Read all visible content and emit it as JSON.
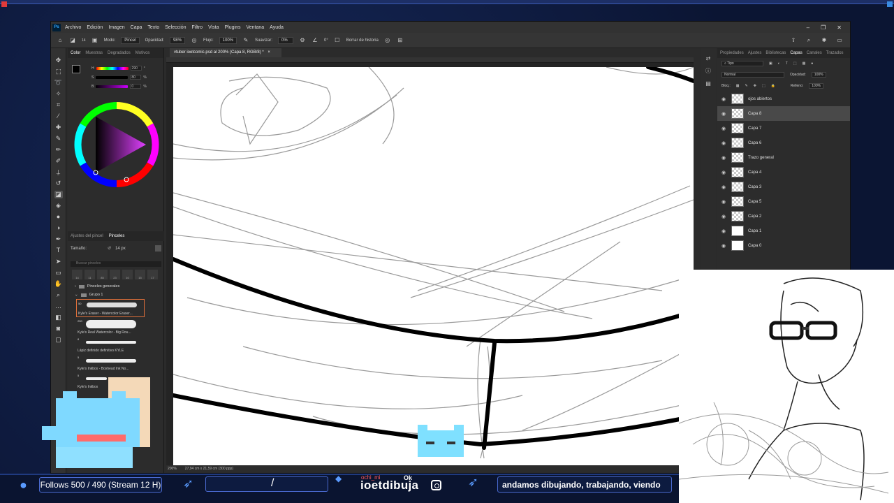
{
  "app": {
    "logo": "Ps",
    "menu": [
      "Archivo",
      "Edición",
      "Imagen",
      "Capa",
      "Texto",
      "Selección",
      "Filtro",
      "Vista",
      "Plugins",
      "Ventana",
      "Ayuda"
    ]
  },
  "options": {
    "mode_label": "Modo:",
    "mode_value": "Pincel",
    "opacity_label": "Opacidad:",
    "opacity_value": "98%",
    "flow_label": "Flujo:",
    "flow_value": "100%",
    "smooth_label": "Suavizar:",
    "smooth_value": "0%",
    "angle_value": "0°",
    "history_label": "Borrar de historia",
    "brush_size_small": "14"
  },
  "color_panel": {
    "tabs": [
      "Color",
      "Muestras",
      "Degradados",
      "Motivos"
    ],
    "slider_values": [
      "290",
      "80",
      "0"
    ],
    "slider_units": [
      "°",
      "%",
      "%"
    ],
    "slider_labels": [
      "H",
      "S",
      "B"
    ]
  },
  "brush_panel": {
    "tabs": [
      "Ajustes del pincel",
      "Pinceles"
    ],
    "size_label": "Tamaño:",
    "size_value": "14 px",
    "search_placeholder": "Buscar pinceles",
    "presets": [
      "14",
      "11",
      "85",
      "23",
      "10",
      "15",
      "17"
    ],
    "group_general": "Pinceles generales",
    "group1": "Grupo 1",
    "brushes": [
      {
        "size": "50",
        "name": "Kyle's Eraser - Watercolor Eraser..."
      },
      {
        "size": "250",
        "name": "Kyle's Real Watercolor - Big Rou..."
      },
      {
        "size": "8",
        "name": "Lápiz definido definitivo KYLE"
      },
      {
        "size": "5",
        "name": "Kyle's Inkbox - Boxhead Ink No..."
      },
      {
        "size": "5",
        "name": "Kyle's Inkbox"
      }
    ]
  },
  "document": {
    "tab_title": "vtuber ioetcomic.psd al 200% (Capa 8, RGB/8) *",
    "zoom": "200%",
    "doc_info": "27,94 cm x 21,59 cm (300 ppp)"
  },
  "layers": {
    "tabs": [
      "Propiedades",
      "Ajustes",
      "Bibliotecas",
      "Capas",
      "Canales",
      "Trazados"
    ],
    "kind_label": "Tipo",
    "blend_mode": "Normal",
    "opacity_label": "Opacidad:",
    "opacity_value": "100%",
    "lock_label": "Bloq.:",
    "fill_label": "Relleno:",
    "fill_value": "100%",
    "items": [
      {
        "name": "ojos abiertos"
      },
      {
        "name": "Capa 8"
      },
      {
        "name": "Capa 7"
      },
      {
        "name": "Capa 6"
      },
      {
        "name": "Trazo general"
      },
      {
        "name": "Capa 4"
      },
      {
        "name": "Capa 3"
      },
      {
        "name": "Capa 5"
      },
      {
        "name": "Capa 2"
      },
      {
        "name": "Capa 1"
      },
      {
        "name": "Capa 0"
      }
    ]
  },
  "stream": {
    "follows": "Follows 500 / 490 (Stream 12 H)",
    "chat_user": "ochi_mi",
    "chat_msg": "Ok",
    "handle": "ioetdibuja",
    "ticker": "andamos dibujando, trabajando, viendo"
  },
  "colors": {
    "accent": "#e0703a",
    "stream_border": "#4a6ad0",
    "ps_blue": "#31a8ff"
  }
}
